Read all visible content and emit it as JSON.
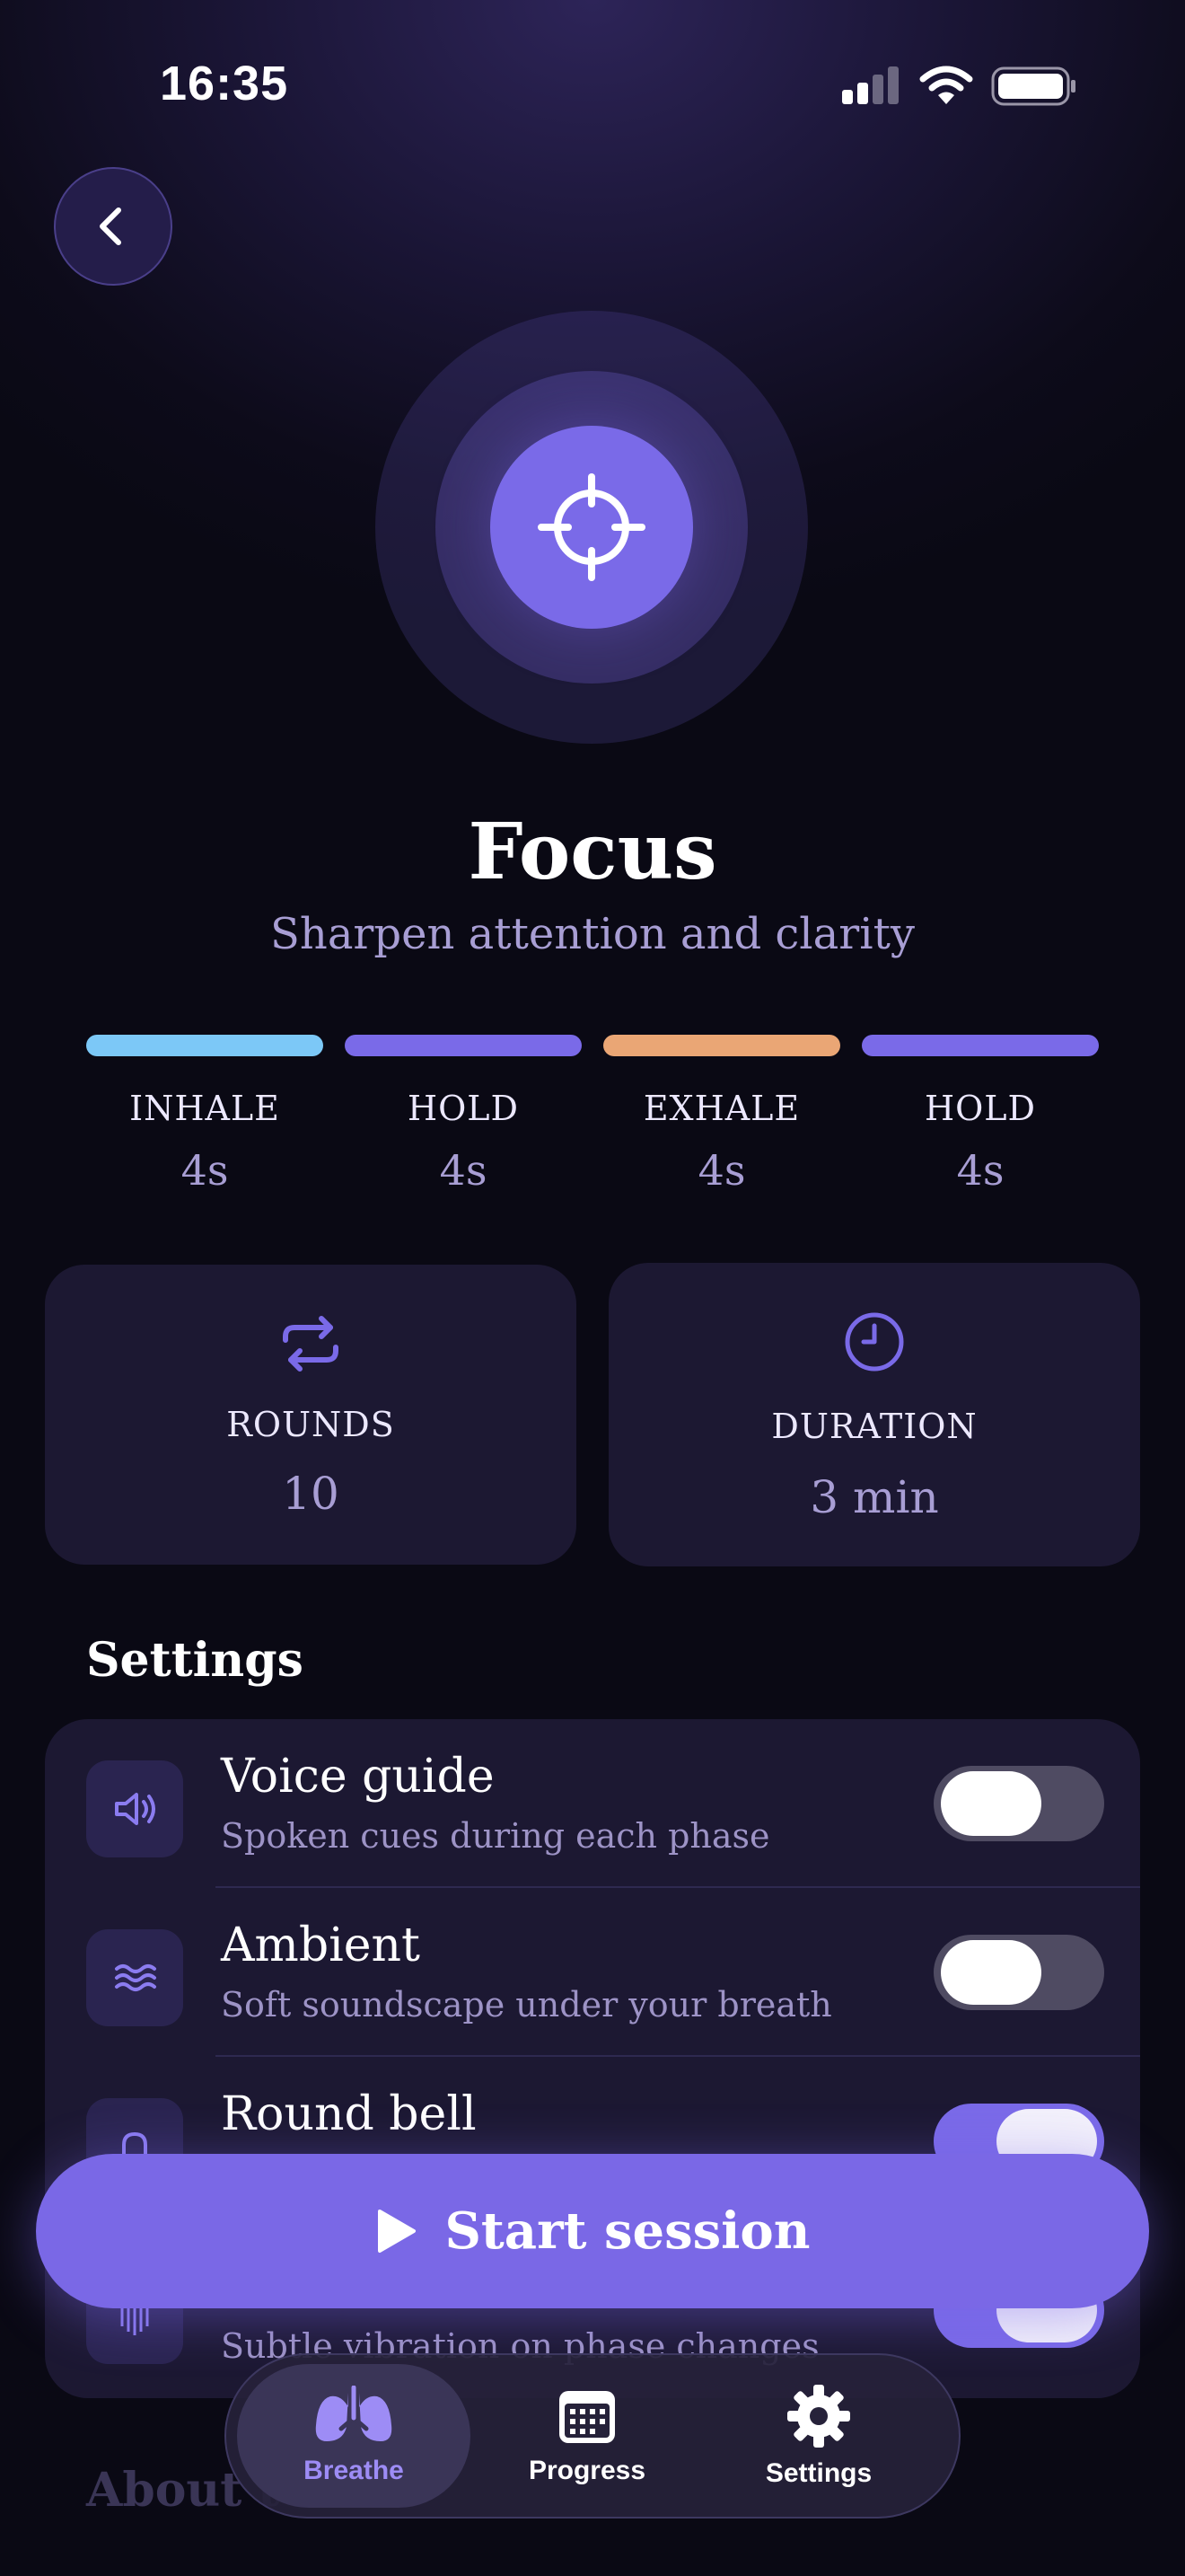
{
  "status_bar": {
    "time": "16:35"
  },
  "exercise": {
    "title": "Focus",
    "subtitle": "Sharpen attention and clarity",
    "icon": "crosshair-icon"
  },
  "phases": [
    {
      "label": "INHALE",
      "value": "4s",
      "color": "#7cc8f7"
    },
    {
      "label": "HOLD",
      "value": "4s",
      "color": "#7a6ae8"
    },
    {
      "label": "EXHALE",
      "value": "4s",
      "color": "#eaa675"
    },
    {
      "label": "HOLD",
      "value": "4s",
      "color": "#7a6ae8"
    }
  ],
  "stats": {
    "rounds": {
      "label": "ROUNDS",
      "value": "10",
      "icon": "repeat-icon"
    },
    "duration": {
      "label": "DURATION",
      "value": "3 min",
      "icon": "clock-icon"
    }
  },
  "settings": {
    "heading": "Settings",
    "rows": [
      {
        "title": "Voice guide",
        "subtitle": "Spoken cues during each phase",
        "icon": "speaker-icon",
        "enabled": false
      },
      {
        "title": "Ambient",
        "subtitle": "Soft soundscape under your breath",
        "icon": "waves-icon",
        "enabled": false
      },
      {
        "title": "Round bell",
        "subtitle": "",
        "icon": "bell-icon",
        "enabled": true
      },
      {
        "title": "",
        "subtitle": "Subtle vibration on phase changes",
        "icon": "vibration-icon",
        "enabled": true
      }
    ]
  },
  "about": {
    "heading": "About t"
  },
  "start_button": {
    "label": "Start session"
  },
  "tabbar": {
    "tabs": [
      {
        "label": "Breathe",
        "icon": "lungs-icon",
        "active": true
      },
      {
        "label": "Progress",
        "icon": "calendar-icon",
        "active": false
      },
      {
        "label": "Settings",
        "icon": "gear-icon",
        "active": false
      }
    ]
  },
  "colors": {
    "accent": "#7a6ae8",
    "background": "#0d0b1a",
    "card": "#1c1832",
    "muted_text": "#a89ed4"
  }
}
